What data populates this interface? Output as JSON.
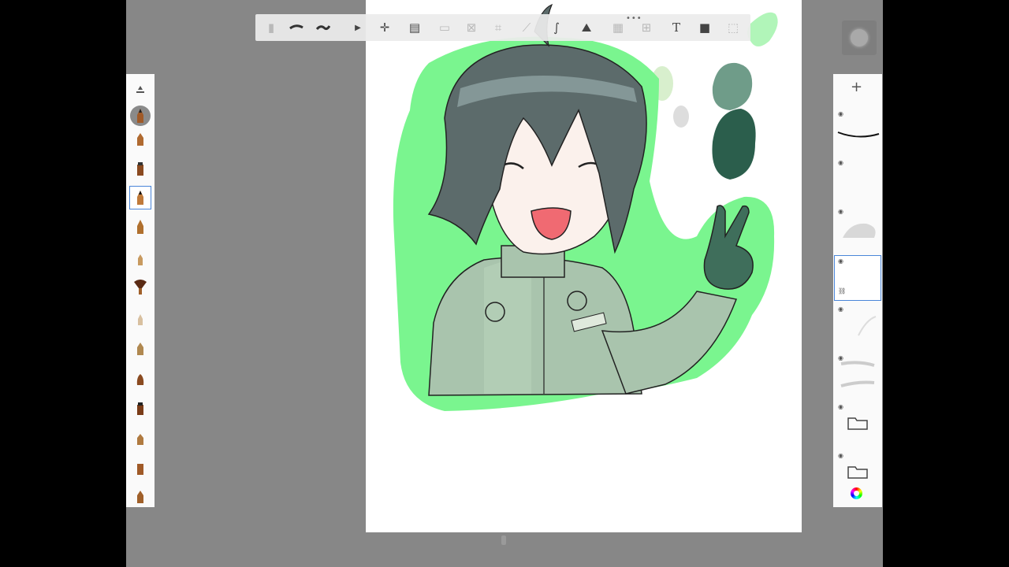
{
  "app": {
    "name": "Sketch drawing app",
    "accent_color": "#4a86d9",
    "canvas_bg": "#878787",
    "highlight_color": "#7af58f"
  },
  "toolbar": {
    "handle_label": "•••",
    "tools": [
      {
        "icon": "menu-icon"
      },
      {
        "icon": "brush-stroke-icon"
      },
      {
        "icon": "smooth-stroke-icon"
      },
      {
        "icon": "arrow-icon"
      },
      {
        "icon": "transform-icon"
      },
      {
        "icon": "crop-icon"
      },
      {
        "icon": "selection-icon"
      },
      {
        "icon": "symmetry-icon"
      },
      {
        "icon": "perspective-icon"
      },
      {
        "icon": "ruler-icon"
      },
      {
        "icon": "curve-icon"
      },
      {
        "icon": "image-icon"
      },
      {
        "icon": "stamp-icon"
      },
      {
        "icon": "fill-icon"
      },
      {
        "icon": "text-icon",
        "label": "T"
      },
      {
        "icon": "video-icon"
      },
      {
        "icon": "fullscreen-icon"
      }
    ]
  },
  "brush_panel": {
    "selected_index": 3,
    "brushes": [
      "pencil",
      "pencil-soft",
      "marker",
      "ballpoint",
      "technical-pen",
      "airbrush",
      "fan-brush",
      "blender",
      "eraser",
      "paint-brush",
      "chisel",
      "smudge",
      "flat-brush",
      "chalk"
    ]
  },
  "layer_panel": {
    "add_label": "+",
    "selected_index": 3,
    "layers": [
      "line-art",
      "empty-layer",
      "shading-layer",
      "active-layer",
      "sketch-layer",
      "rough-sketch-layer",
      "folder-1",
      "folder-2"
    ]
  },
  "palette_swatches": [
    "#9fd89f",
    "#b8b8b8",
    "#6f9c89",
    "#2b5e4c"
  ]
}
